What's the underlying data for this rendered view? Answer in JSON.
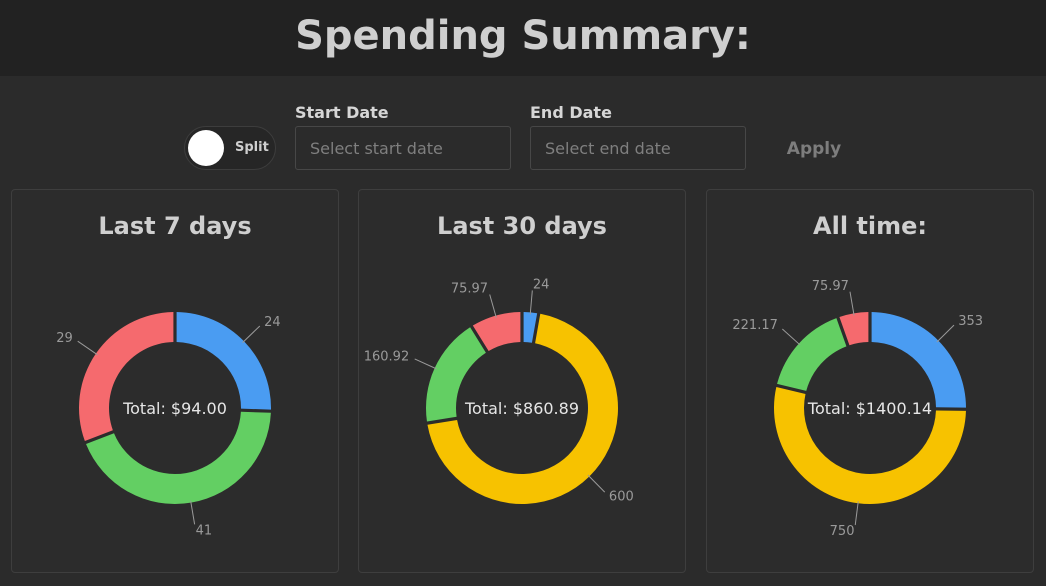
{
  "page": {
    "title": "Spending Summary:"
  },
  "controls": {
    "toggle_label": "Split",
    "start_date": {
      "label": "Start Date",
      "placeholder": "Select start date",
      "value": ""
    },
    "end_date": {
      "label": "End Date",
      "placeholder": "Select end date",
      "value": ""
    },
    "apply_label": "Apply"
  },
  "colors": {
    "blue": "#4a9cf2",
    "green": "#63cf63",
    "red": "#f56a6e",
    "yellow": "#f7c200",
    "leader": "#9a9a9a"
  },
  "cards": [
    {
      "title": "Last 7 days",
      "total": "Total: $94.00"
    },
    {
      "title": "Last 30 days",
      "total": "Total: $860.89"
    },
    {
      "title": "All time:",
      "total": "Total: $1400.14"
    }
  ],
  "chart_data": [
    {
      "type": "pie",
      "title": "Last 7 days",
      "center_label": "Total: $94.00",
      "categories": [
        "blue",
        "green",
        "red"
      ],
      "values": [
        24,
        41,
        29
      ],
      "value_labels": [
        "24",
        "41",
        "29"
      ],
      "colors": [
        "#4a9cf2",
        "#63cf63",
        "#f56a6e"
      ]
    },
    {
      "type": "pie",
      "title": "Last 30 days",
      "center_label": "Total: $860.89",
      "categories": [
        "blue",
        "yellow",
        "green",
        "red"
      ],
      "values": [
        24,
        600,
        160.92,
        75.97
      ],
      "value_labels": [
        "24",
        "600",
        "160.92",
        "75.97"
      ],
      "colors": [
        "#4a9cf2",
        "#f7c200",
        "#63cf63",
        "#f56a6e"
      ]
    },
    {
      "type": "pie",
      "title": "All time:",
      "center_label": "Total: $1400.14",
      "categories": [
        "blue",
        "yellow",
        "green",
        "red"
      ],
      "values": [
        353,
        750,
        221.17,
        75.97
      ],
      "value_labels": [
        "353",
        "750",
        "221.17",
        "75.97"
      ],
      "colors": [
        "#4a9cf2",
        "#f7c200",
        "#63cf63",
        "#f56a6e"
      ]
    }
  ]
}
